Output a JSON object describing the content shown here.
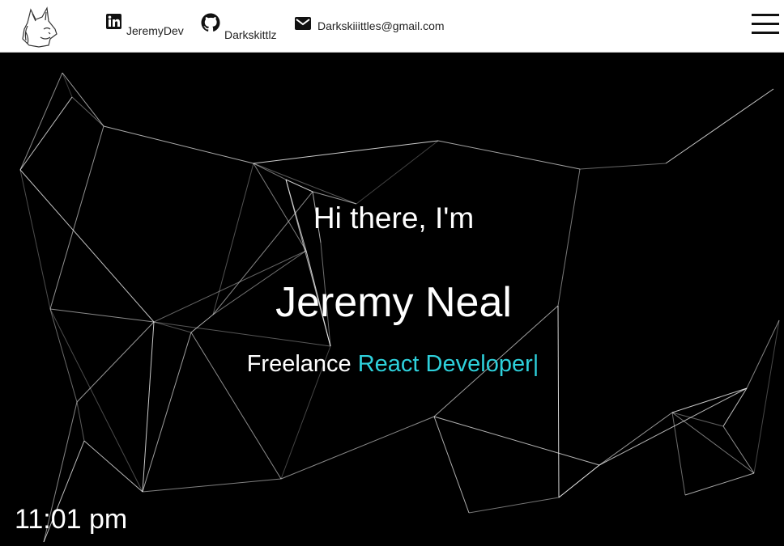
{
  "header": {
    "logo_icon": "cat-head-logo-icon",
    "social": [
      {
        "icon": "linkedin-icon",
        "label": "JeremyDev"
      },
      {
        "icon": "github-icon",
        "label": "Darkskittlz"
      },
      {
        "icon": "mail-icon",
        "label": "Darkskiiittles@gmail.com"
      }
    ],
    "menu_icon": "hamburger-menu-icon"
  },
  "hero": {
    "greeting": "Hi there, I'm",
    "name": "Jeremy Neal",
    "role_prefix": "Freelance",
    "role_typed": "React Developer|",
    "accent_color": "#2ed1dc",
    "background": "#000000"
  },
  "clock": "11:01 pm"
}
